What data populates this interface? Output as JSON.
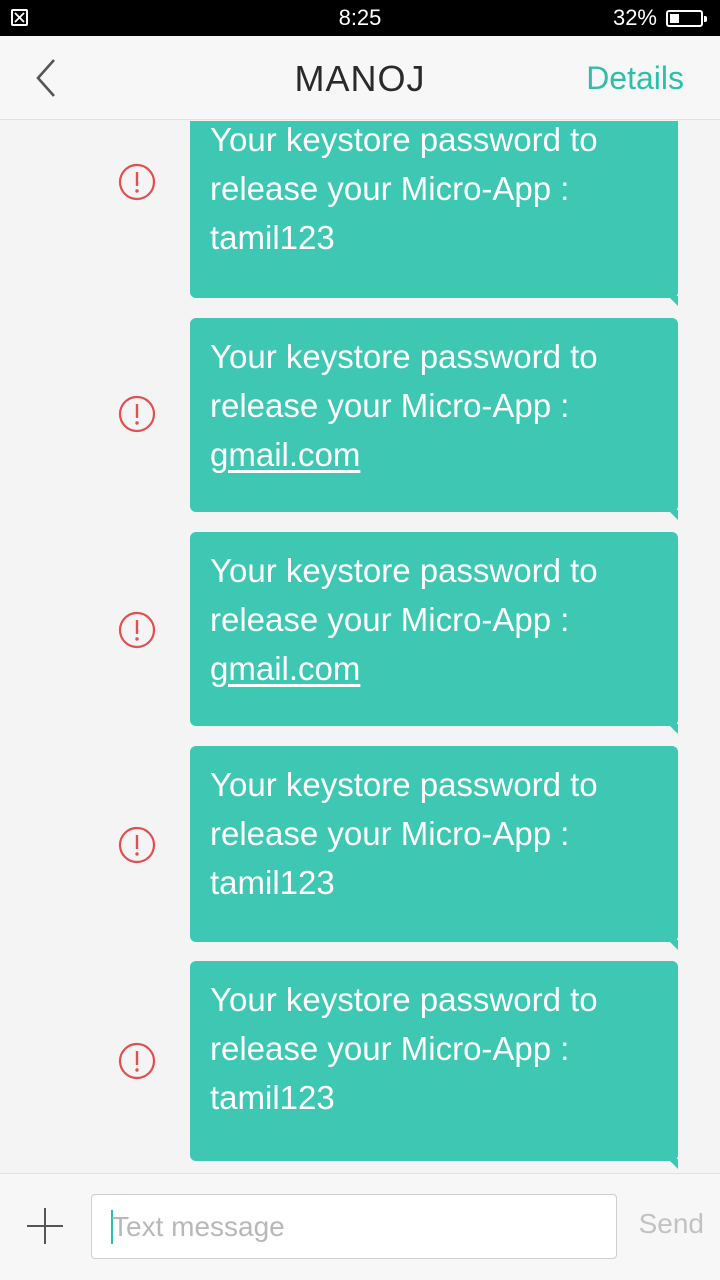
{
  "status_bar": {
    "time": "8:25",
    "battery_percent_label": "32%",
    "battery_level": 0.32
  },
  "header": {
    "title": "MANOJ",
    "details_label": "Details"
  },
  "colors": {
    "accent": "#2fbfa8",
    "bubble": "#3ec8b4",
    "error": "#e0504f"
  },
  "messages": [
    {
      "line1": "Your keystore password to",
      "line2": "release your Micro-App :",
      "value": "tamil123",
      "value_is_link": false
    },
    {
      "line1": "Your keystore password to",
      "line2": "release your Micro-App :",
      "value": "gmail.com",
      "value_is_link": true
    },
    {
      "line1": "Your keystore password to",
      "line2": "release your Micro-App :",
      "value": "gmail.com",
      "value_is_link": true
    },
    {
      "line1": "Your keystore password to",
      "line2": "release your Micro-App :",
      "value": "tamil123",
      "value_is_link": false
    },
    {
      "line1": "Your keystore password to",
      "line2": "release your Micro-App :",
      "value": "tamil123",
      "value_is_link": false
    }
  ],
  "composer": {
    "placeholder": "Text message",
    "value": "",
    "send_label": "Send"
  }
}
